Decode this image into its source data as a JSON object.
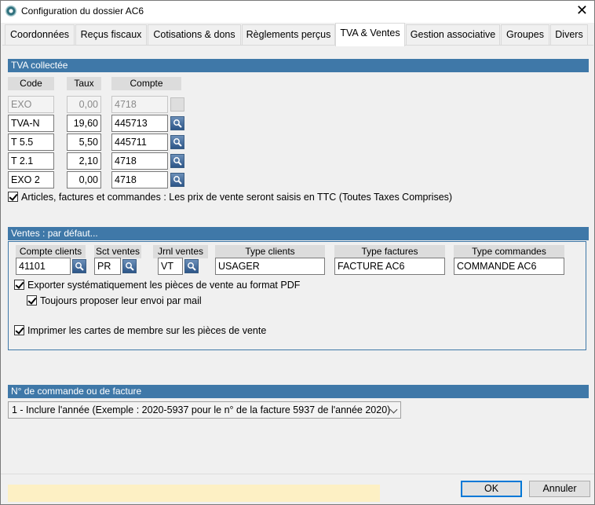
{
  "window": {
    "title": "Configuration du dossier AC6"
  },
  "tabs": [
    {
      "label": "Coordonnées"
    },
    {
      "label": "Reçus fiscaux"
    },
    {
      "label": "Cotisations & dons"
    },
    {
      "label": "Règlements perçus"
    },
    {
      "label": "TVA & Ventes"
    },
    {
      "label": "Gestion associative"
    },
    {
      "label": "Groupes"
    },
    {
      "label": "Divers"
    }
  ],
  "active_tab": "TVA & Ventes",
  "tva": {
    "section_title": "TVA collectée",
    "headers": {
      "code": "Code",
      "taux": "Taux",
      "compte": "Compte"
    },
    "rows": [
      {
        "code": "EXO",
        "taux": "0,00",
        "compte": "4718"
      },
      {
        "code": "TVA-N",
        "taux": "19,60",
        "compte": "445713"
      },
      {
        "code": "T 5.5",
        "taux": "5,50",
        "compte": "445711"
      },
      {
        "code": "T 2.1",
        "taux": "2,10",
        "compte": "4718"
      },
      {
        "code": "EXO 2",
        "taux": "0,00",
        "compte": "4718"
      }
    ],
    "ttc_checkbox_label": "Articles, factures et commandes : Les prix de vente seront saisis en TTC (Toutes Taxes Comprises)"
  },
  "ventes": {
    "section_title": "Ventes : par défaut...",
    "headers": {
      "compte_clients": "Compte clients",
      "sct_ventes": "Sct ventes",
      "jrnl_ventes": "Jrnl ventes",
      "type_clients": "Type clients",
      "type_factures": "Type factures",
      "type_commandes": "Type commandes"
    },
    "values": {
      "compte_clients": "41101",
      "sct_ventes": "PR",
      "jrnl_ventes": "VT",
      "type_clients": "USAGER",
      "type_factures": "FACTURE AC6",
      "type_commandes": "COMMANDE AC6"
    },
    "export_pdf_label": "Exporter systématiquement les pièces de vente au format PDF",
    "send_mail_label": "Toujours proposer leur envoi par mail",
    "print_cards_label": "Imprimer les cartes de membre sur les pièces de vente"
  },
  "numbering": {
    "section_title": "N° de commande ou de facture",
    "selected": "1 - Inclure l'année (Exemple : 2020-5937 pour le n° de la facture 5937 de l'année 2020)"
  },
  "buttons": {
    "ok": "OK",
    "cancel": "Annuler"
  },
  "colors": {
    "section_bar": "#3f78a8",
    "status_bar": "#fdf0c4",
    "accent": "#0078d7"
  }
}
